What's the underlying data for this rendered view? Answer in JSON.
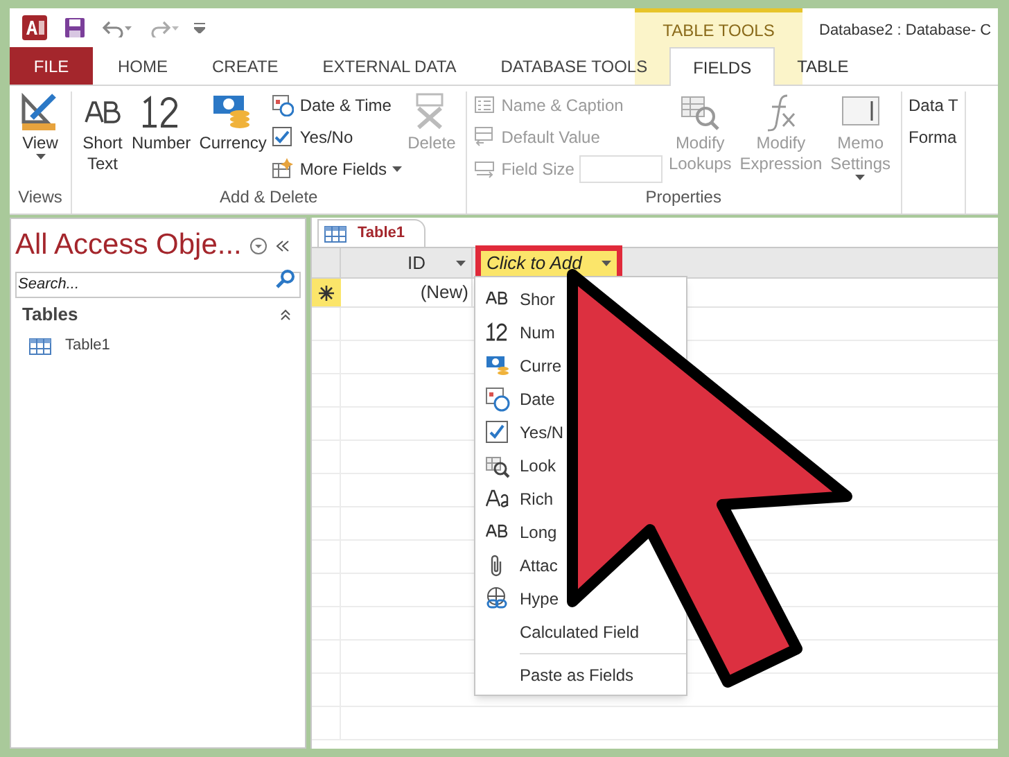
{
  "window": {
    "title": "Database2 : Database- C",
    "context_label": "TABLE TOOLS"
  },
  "tabs": [
    {
      "label": "FILE",
      "kind": "file",
      "selected": false
    },
    {
      "label": "HOME",
      "kind": "normal",
      "selected": false
    },
    {
      "label": "CREATE",
      "kind": "normal",
      "selected": false
    },
    {
      "label": "EXTERNAL DATA",
      "kind": "normal",
      "selected": false
    },
    {
      "label": "DATABASE TOOLS",
      "kind": "normal",
      "selected": false
    },
    {
      "label": "FIELDS",
      "kind": "context",
      "selected": true
    },
    {
      "label": "TABLE",
      "kind": "context",
      "selected": false
    }
  ],
  "ribbon": {
    "groups": [
      {
        "label": "Views",
        "items": [
          {
            "label": "View",
            "kind": "large",
            "dropdown": true,
            "disabled": false
          }
        ]
      },
      {
        "label": "Add & Delete",
        "items": [
          {
            "label": "Short Text",
            "kind": "large",
            "dropdown": false,
            "disabled": false
          },
          {
            "label": "Number",
            "kind": "large",
            "dropdown": false,
            "disabled": false
          },
          {
            "label": "Currency",
            "kind": "large",
            "dropdown": false,
            "disabled": false
          },
          {
            "label": "Date & Time",
            "kind": "small",
            "dropdown": false,
            "disabled": false
          },
          {
            "label": "Yes/No",
            "kind": "small",
            "dropdown": false,
            "disabled": false
          },
          {
            "label": "More Fields",
            "kind": "small",
            "dropdown": true,
            "disabled": false
          },
          {
            "label": "Delete",
            "kind": "large",
            "dropdown": false,
            "disabled": true
          }
        ]
      },
      {
        "label": "Properties",
        "items": [
          {
            "label": "Name & Caption",
            "kind": "small",
            "dropdown": false,
            "disabled": true
          },
          {
            "label": "Default Value",
            "kind": "small",
            "dropdown": false,
            "disabled": true
          },
          {
            "label": "Field Size",
            "kind": "field",
            "dropdown": false,
            "disabled": true
          },
          {
            "label": "Modify Lookups",
            "kind": "large",
            "dropdown": false,
            "disabled": true
          },
          {
            "label": "Modify Expression",
            "kind": "large",
            "dropdown": false,
            "disabled": true
          },
          {
            "label": "Memo Settings",
            "kind": "large",
            "dropdown": true,
            "disabled": true
          }
        ]
      },
      {
        "items": [
          {
            "label": "Data T",
            "kind": "small",
            "dropdown": false,
            "disabled": false
          },
          {
            "label": "Forma",
            "kind": "small",
            "dropdown": false,
            "disabled": false
          }
        ]
      }
    ]
  },
  "navigation": {
    "title": "All Access Obje...",
    "search": {
      "placeholder": "Search..."
    },
    "section": "Tables",
    "items": [
      {
        "label": "Table1"
      }
    ]
  },
  "document": {
    "tab": "Table1",
    "columns": [
      {
        "label": "ID",
        "kind": "field"
      },
      {
        "label": "Click to Add",
        "kind": "add"
      }
    ],
    "new_row": "(New)"
  },
  "menu": {
    "items": [
      {
        "label": "Shor",
        "kind": "short"
      },
      {
        "label": "Num",
        "kind": "number"
      },
      {
        "label": "Curre",
        "kind": "currency"
      },
      {
        "label": "Date",
        "kind": "date"
      },
      {
        "label": "Yes/N",
        "kind": "yesno"
      },
      {
        "label": "Look",
        "kind": "lookup"
      },
      {
        "label": "Rich",
        "kind": "rich"
      },
      {
        "label": "Long",
        "kind": "long"
      },
      {
        "label": "Attac",
        "kind": "attach"
      },
      {
        "label": "Hype",
        "kind": "link"
      },
      {
        "label": "Calculated Field",
        "kind": "plain"
      },
      {
        "label": "Paste as Fields",
        "kind": "plain",
        "separator": true
      }
    ]
  }
}
